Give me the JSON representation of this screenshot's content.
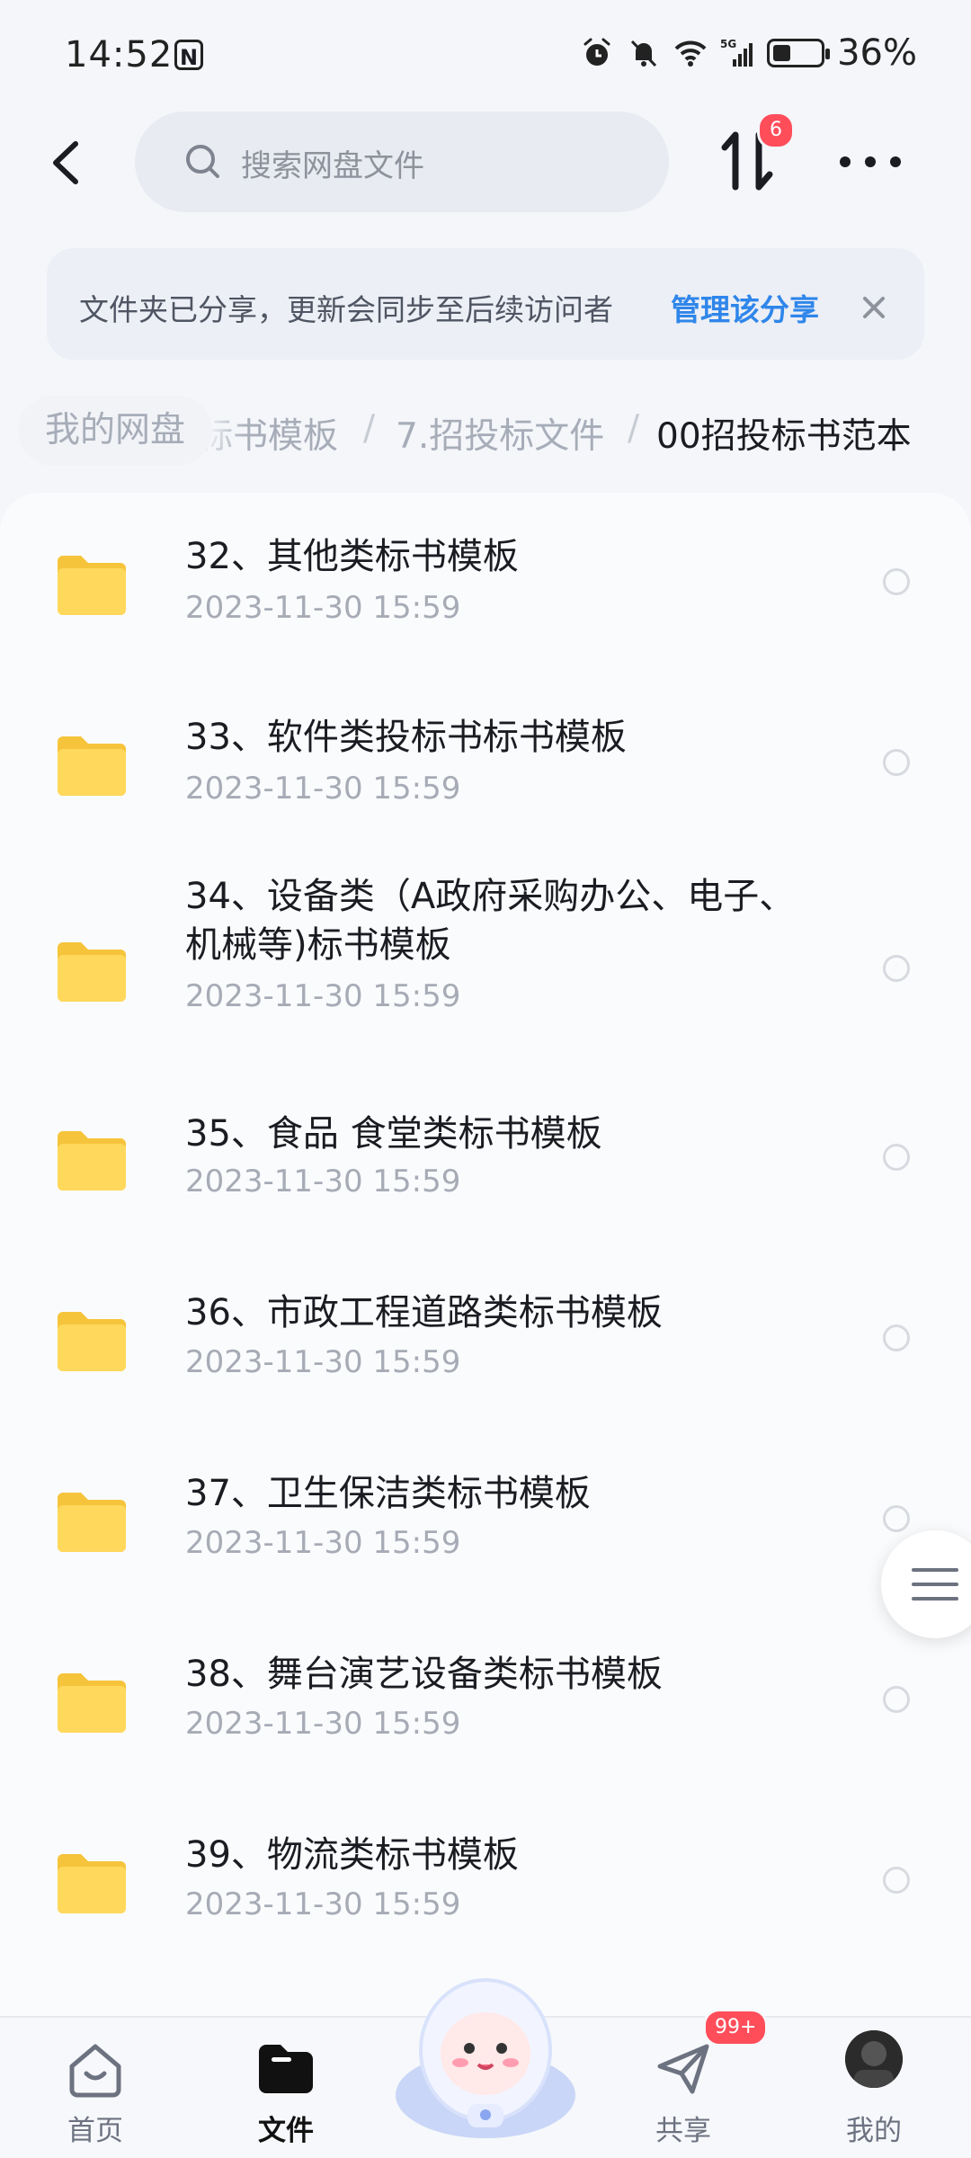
{
  "status": {
    "time": "14:52",
    "battery": "36%",
    "battery_level": 0.36,
    "network": "5G"
  },
  "search": {
    "placeholder": "搜索网盘文件"
  },
  "transfer_badge": "6",
  "notice": {
    "text": "文件夹已分享，更新会同步至后续访问者",
    "link": "管理该分享"
  },
  "breadcrumb": {
    "root": "我的网盘",
    "items": [
      "标书模板",
      "7.招投标文件",
      "00招投标书范本"
    ]
  },
  "files": [
    {
      "name": "32、其他类标书模板",
      "date": "2023-11-30  15:59"
    },
    {
      "name": "33、软件类投标书标书模板",
      "date": "2023-11-30  15:59"
    },
    {
      "name": "34、设备类（A政府采购办公、电子、机械等)标书模板",
      "date": "2023-11-30  15:59"
    },
    {
      "name": "35、食品 食堂类标书模板",
      "date": "2023-11-30  15:59"
    },
    {
      "name": "36、市政工程道路类标书模板",
      "date": "2023-11-30  15:59"
    },
    {
      "name": "37、卫生保洁类标书模板",
      "date": "2023-11-30  15:59"
    },
    {
      "name": "38、舞台演艺设备类标书模板",
      "date": "2023-11-30  15:59"
    },
    {
      "name": "39、物流类标书模板",
      "date": "2023-11-30  15:59"
    }
  ],
  "nav": {
    "home": "首页",
    "files": "文件",
    "share": "共享",
    "share_badge": "99+",
    "mine": "我的"
  },
  "colors": {
    "accent": "#2f86ea",
    "badge": "#ff4d5a",
    "folder": "#ffd34d"
  }
}
